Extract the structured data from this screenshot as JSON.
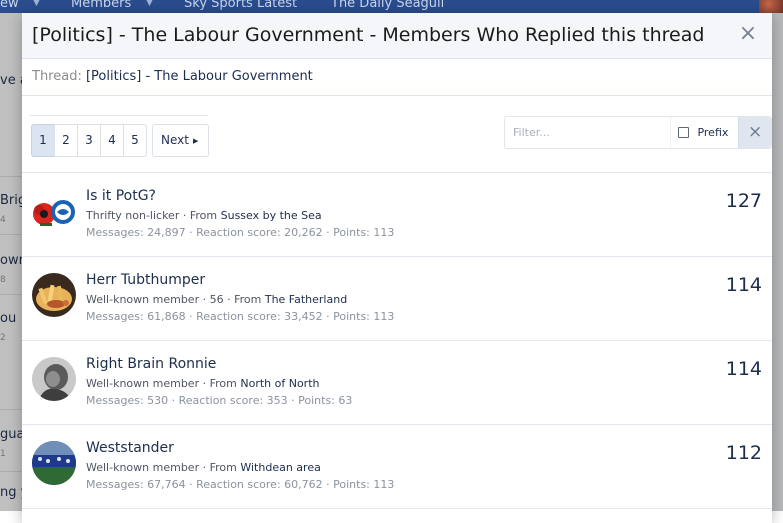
{
  "background": {
    "nav_items": [
      "ew",
      "Members",
      "Sky Sports Latest",
      "The Daily Seagull"
    ],
    "snippets": [
      "ve a",
      "Brig",
      "owr",
      "ou",
      "gua",
      "ng y"
    ],
    "snippet_subs": [
      "4",
      "8",
      "2",
      "1"
    ]
  },
  "modal": {
    "title": "[Politics] - The Labour Government - Members Who Replied this thread",
    "close_label": "×",
    "thread_label": "Thread:",
    "thread_value": "[Politics] - The Labour Government"
  },
  "pagination": {
    "pages": [
      "1",
      "2",
      "3",
      "4",
      "5"
    ],
    "current": "1",
    "next_label": "Next",
    "next_arrow": "▶"
  },
  "filter": {
    "placeholder": "Filter...",
    "prefix_label": "Prefix",
    "clear_label": "×"
  },
  "members": [
    {
      "username": "Is it PotG?",
      "title": "Thrifty non-licker",
      "from_label": "From",
      "location": "Sussex by the Sea",
      "stats": "Messages: 24,897 · Reaction score: 20,262 · Points: 113",
      "count": "127",
      "avatar": "poppy-seagull-badge"
    },
    {
      "username": "Herr Tubthumper",
      "title": "Well-known member · 56 ·",
      "from_label": "From",
      "location": "The Fatherland",
      "stats": "Messages: 61,868 · Reaction score: 33,452 · Points: 113",
      "count": "114",
      "avatar": "food-photo"
    },
    {
      "username": "Right Brain Ronnie",
      "title": "Well-known member ·",
      "from_label": "From",
      "location": "North of North",
      "stats": "Messages: 530 · Reaction score: 353 · Points: 63",
      "count": "114",
      "avatar": "grey-portrait"
    },
    {
      "username": "Weststander",
      "title": "Well-known member ·",
      "from_label": "From",
      "location": "Withdean area",
      "stats": "Messages: 67,764 · Reaction score: 60,762 · Points: 113",
      "count": "112",
      "avatar": "stadium-crowd"
    }
  ],
  "colors": {
    "accent": "#1d2d4d",
    "nav": "#2a4d8e",
    "current_page": "#dbe4f1"
  }
}
